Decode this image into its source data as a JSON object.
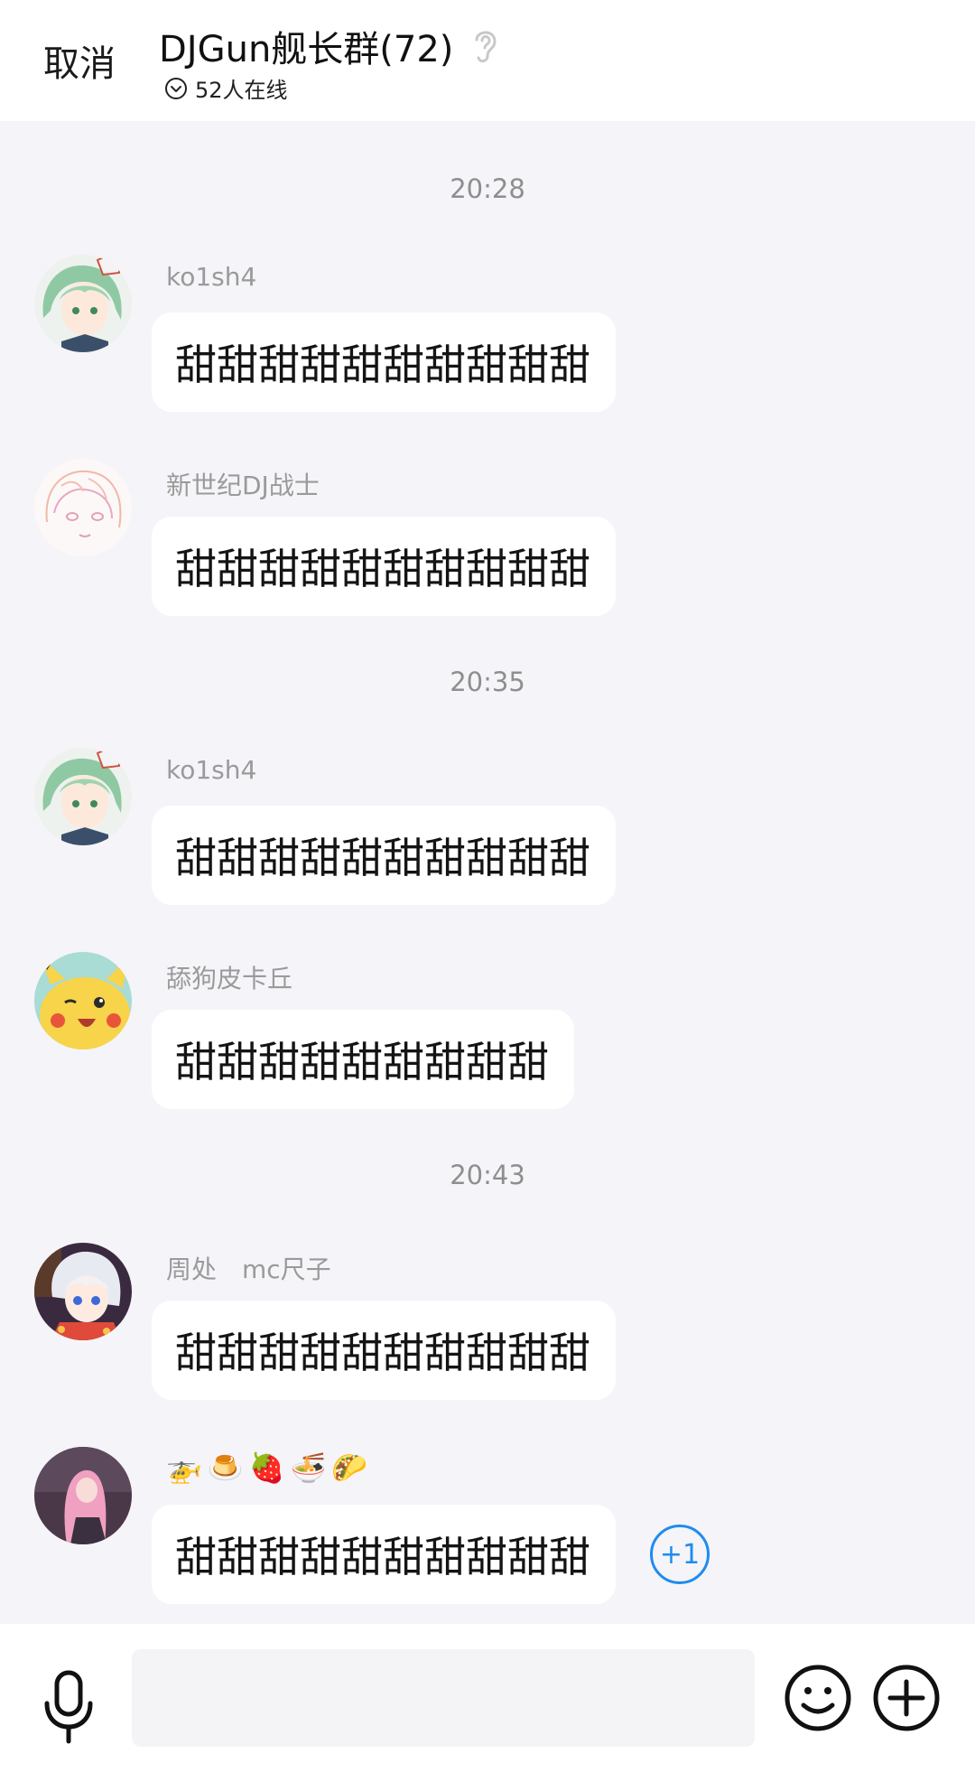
{
  "header": {
    "cancel_label": "取消",
    "title": "DJGun舰长群(72)",
    "online_text": "52人在线"
  },
  "messages": [
    {
      "type": "time",
      "text": "20:28"
    },
    {
      "type": "msg",
      "sender": "ko1sh4",
      "text": "甜甜甜甜甜甜甜甜甜甜",
      "avatar": "green-hair-avatar"
    },
    {
      "type": "msg",
      "sender": "新世纪DJ战士",
      "text": "甜甜甜甜甜甜甜甜甜甜",
      "avatar": "sketch-avatar"
    },
    {
      "type": "time",
      "text": "20:35"
    },
    {
      "type": "msg",
      "sender": "ko1sh4",
      "text": "甜甜甜甜甜甜甜甜甜甜",
      "avatar": "green-hair-avatar"
    },
    {
      "type": "msg",
      "sender": "舔狗皮卡丘",
      "text": "甜甜甜甜甜甜甜甜甜",
      "avatar": "pikachu-avatar"
    },
    {
      "type": "time",
      "text": "20:43"
    },
    {
      "type": "msg",
      "sender": "周处　mc尺子",
      "text": "甜甜甜甜甜甜甜甜甜甜",
      "avatar": "silver-hair-avatar"
    },
    {
      "type": "msg",
      "sender_emojis": [
        "🚁",
        "🍮",
        "🍓",
        "🍜",
        "🌮"
      ],
      "text": "甜甜甜甜甜甜甜甜甜甜",
      "avatar": "pink-hair-avatar",
      "plus_one": "+1"
    }
  ],
  "composer": {
    "placeholder": ""
  },
  "colors": {
    "accent": "#1e8cf0",
    "background": "#f5f4f8",
    "bubble": "#ffffff"
  }
}
